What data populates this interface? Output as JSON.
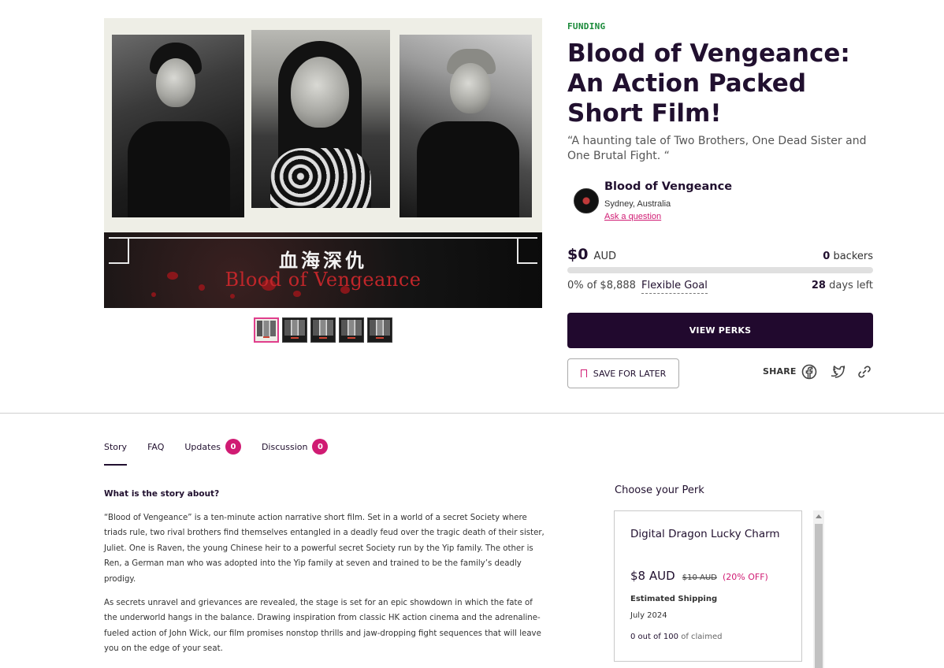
{
  "hero": {
    "banner_cn": "血海深仇",
    "banner_en": "Blood of Vengeance"
  },
  "thumbnails": {
    "count": 5,
    "active_index": 0
  },
  "campaign": {
    "status": "FUNDING",
    "title": "Blood of Vengeance: An Action Packed Short Film!",
    "tagline": "“A haunting tale of Two Brothers, One Dead Sister and One Brutal Fight. “"
  },
  "owner": {
    "name": "Blood of Vengeance",
    "location": "Sydney, Australia",
    "ask_link": "Ask a question"
  },
  "funding": {
    "raised": "$0",
    "currency": "AUD",
    "backers_count": "0",
    "backers_label": "backers",
    "percent_text": "0% of $8,888",
    "goal_type": "Flexible Goal",
    "progress_fraction": 0,
    "days_count": "28",
    "days_label": "days left"
  },
  "actions": {
    "view_perks": "VIEW PERKS",
    "save_for_later": "SAVE FOR LATER",
    "share_label": "SHARE"
  },
  "share_icons": [
    "facebook-icon",
    "twitter-icon",
    "link-icon"
  ],
  "tabs": [
    {
      "label": "Story",
      "badge": ""
    },
    {
      "label": "FAQ",
      "badge": ""
    },
    {
      "label": "Updates",
      "badge": "0"
    },
    {
      "label": "Discussion",
      "badge": "0"
    }
  ],
  "story": {
    "heading": "What is the story about?",
    "paragraph1": "“Blood of Vengeance” is a ten-minute action narrative short film. Set in a world of a secret Society where triads rule, two rival brothers find themselves entangled in a deadly feud over the tragic death of their sister, Juliet. One is Raven, the young Chinese heir to a powerful secret Society run by the Yip family. The other is Ren, a German man who was adopted into the Yip family at seven and trained to be the family’s deadly prodigy.",
    "paragraph2": "As secrets unravel and grievances are revealed, the stage is set for an epic showdown in which the fate of the underworld hangs in the balance. Drawing inspiration from classic HK action cinema and the adrenaline-fueled action of John Wick, our film promises nonstop thrills and jaw-dropping fight sequences that will leave you on the edge of your seat."
  },
  "perks": {
    "heading": "Choose your Perk",
    "items": [
      {
        "title": "Digital Dragon Lucky Charm",
        "price": "$8 AUD",
        "original_price": "$10 AUD",
        "discount": "(20% OFF)",
        "shipping_label": "Estimated Shipping",
        "shipping_date": "July 2024",
        "claimed_count": "0 out of 100",
        "claimed_suffix": "of claimed"
      }
    ]
  },
  "colors": {
    "accent": "#d01b73",
    "primary_dark": "#21092e",
    "funding_green": "#1a8a3a"
  }
}
